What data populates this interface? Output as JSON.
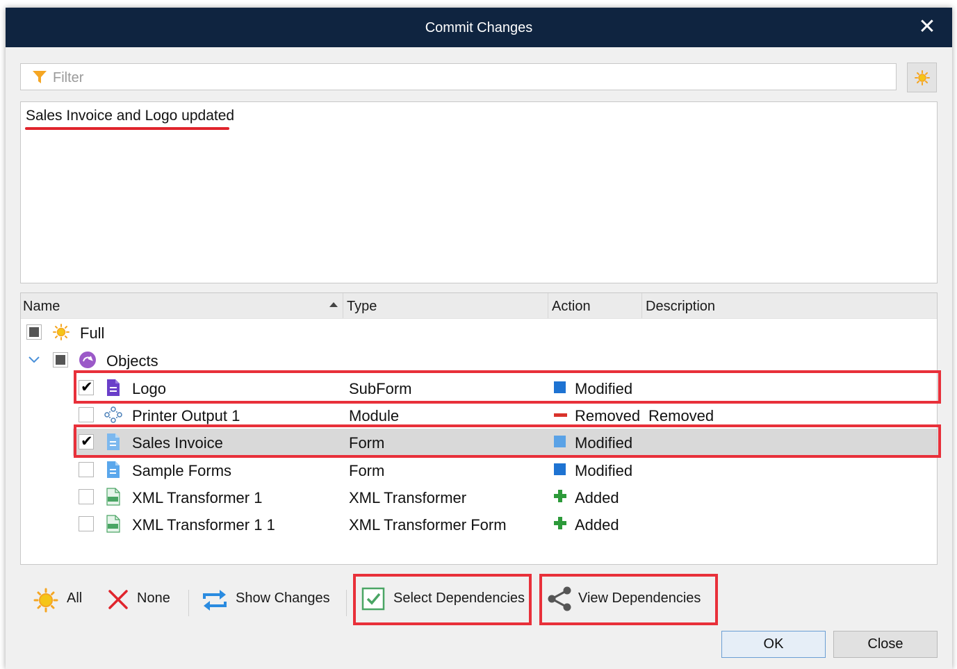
{
  "window": {
    "title": "Commit Changes",
    "close_label": "✕"
  },
  "filter": {
    "placeholder": "Filter",
    "value": ""
  },
  "message": {
    "text": "Sales Invoice and Logo updated"
  },
  "grid": {
    "columns": [
      "Name",
      "Type",
      "Action",
      "Description"
    ],
    "sorted_column": "Name",
    "sort_direction": "ascending",
    "root": {
      "label": "Full",
      "state": "indeterminate"
    },
    "group": {
      "label": "Objects",
      "state": "indeterminate",
      "expanded": true
    },
    "rows": [
      {
        "name": "Logo",
        "type": "SubForm",
        "action": "Modified",
        "description": "",
        "checked": true,
        "icon": "subform-icon",
        "action_icon": "modified-icon",
        "selected": false
      },
      {
        "name": "Printer Output 1",
        "type": "Module",
        "action": "Removed",
        "description": "Removed",
        "checked": false,
        "icon": "module-icon",
        "action_icon": "removed-icon",
        "selected": false
      },
      {
        "name": "Sales Invoice",
        "type": "Form",
        "action": "Modified",
        "description": "",
        "checked": true,
        "icon": "form-icon",
        "action_icon": "modified-icon",
        "selected": true
      },
      {
        "name": "Sample Forms",
        "type": "Form",
        "action": "Modified",
        "description": "",
        "checked": false,
        "icon": "form-icon",
        "action_icon": "modified-icon",
        "selected": false
      },
      {
        "name": "XML Transformer 1",
        "type": "XML Transformer",
        "action": "Added",
        "description": "",
        "checked": false,
        "icon": "xml-icon",
        "action_icon": "added-icon",
        "selected": false
      },
      {
        "name": "XML Transformer 1 1",
        "type": "XML Transformer Form",
        "action": "Added",
        "description": "",
        "checked": false,
        "icon": "xml-icon",
        "action_icon": "added-icon",
        "selected": false
      }
    ]
  },
  "toolbar": {
    "all_label": "All",
    "none_label": "None",
    "show_changes_label": "Show Changes",
    "select_dependencies_label": "Select Dependencies",
    "view_dependencies_label": "View Dependencies"
  },
  "buttons": {
    "ok_label": "OK",
    "close_label": "Close"
  },
  "colors": {
    "titlebar": "#0f2440",
    "highlight": "#e8303a",
    "modified": "#1e73d2",
    "removed": "#d9322b",
    "added": "#2d9a3a",
    "sun": "#f5a623",
    "selected_row": "#d9d9d9"
  }
}
